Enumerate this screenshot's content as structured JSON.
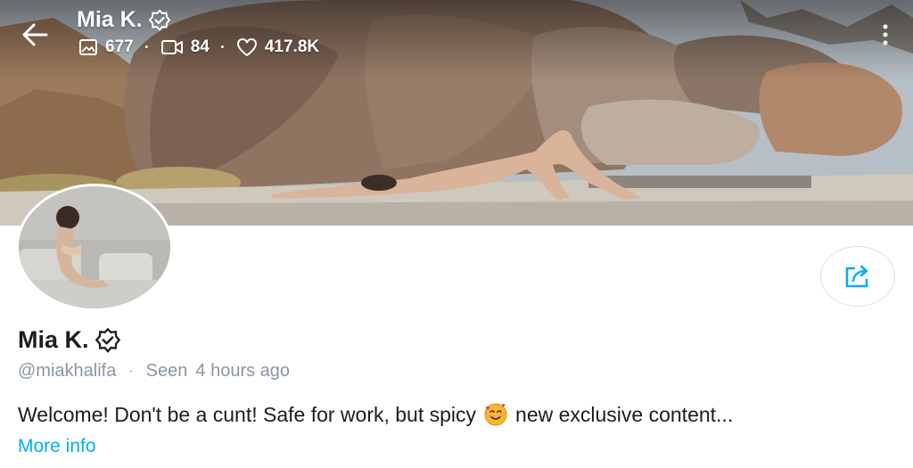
{
  "header": {
    "name": "Mia K.",
    "stats": [
      {
        "icon": "image-icon",
        "value": "677"
      },
      {
        "icon": "video-icon",
        "value": "84"
      },
      {
        "icon": "heart-icon",
        "value": "417.8K"
      }
    ],
    "separator": "·"
  },
  "profile": {
    "name": "Mia K.",
    "handle": "@miakhalifa",
    "separator": "·",
    "seen_label": "Seen",
    "seen_time": "4 hours ago",
    "bio_before_emoji": "Welcome! Don't be a cunt! Safe for work, but spicy",
    "bio_emoji": "smiling-face-with-hearts",
    "bio_after_emoji": "new exclusive content...",
    "more_info": "More info"
  },
  "colors": {
    "accent": "#00aff0",
    "muted": "#8a96a3",
    "text": "#1d1d1d"
  }
}
